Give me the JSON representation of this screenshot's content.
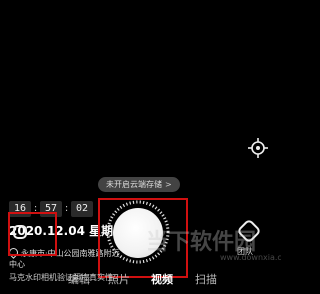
{
  "cloud_pill": {
    "label": "未开启云端存储",
    "chevron": ">"
  },
  "time": {
    "hour": "16",
    "minute": "57",
    "second": "02",
    "sep1": ":",
    "sep2": ":"
  },
  "date": "2020.12.04 星期五",
  "location": {
    "line1": "永康市·中山公园南雅路附近",
    "line2": "中心"
  },
  "bottom": {
    "hint": "马克水印相机验证照片真实性",
    "tabs": [
      "编辑",
      "照片",
      "视频",
      "扫描"
    ],
    "active_tab": "视频"
  },
  "team_label": "团队",
  "icons": {
    "target": "crosshair-icon",
    "team": "team-icon",
    "pin": "pin-icon",
    "left_sq": "watermark-icon"
  },
  "colors": {
    "accent_red": "#d01010",
    "bg": "#000000"
  },
  "watermark": {
    "text": "当下软件园",
    "url": "www.downxia.com"
  }
}
